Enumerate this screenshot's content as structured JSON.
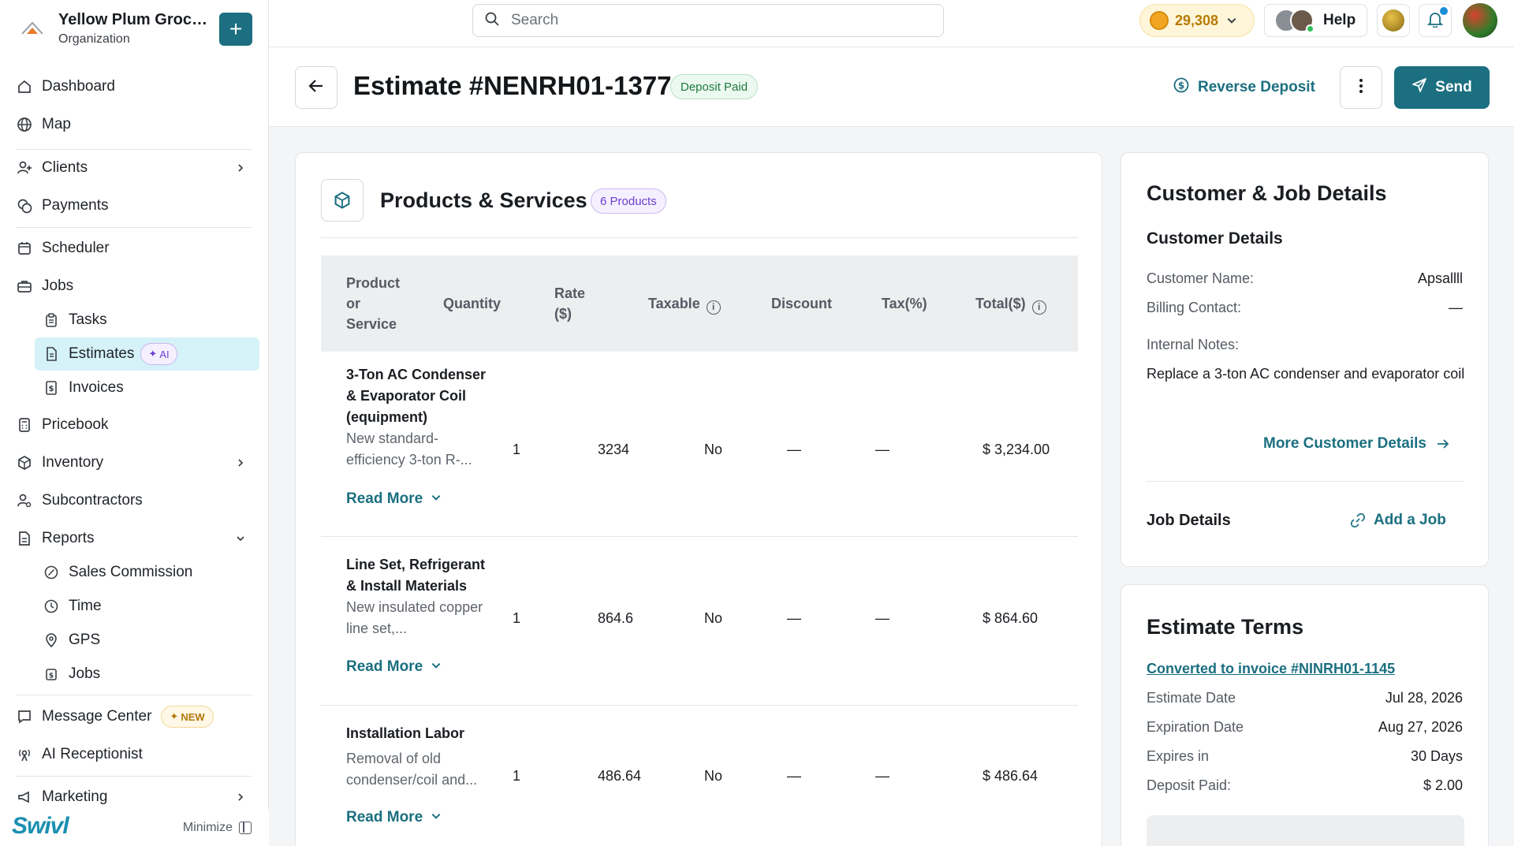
{
  "org": {
    "name": "Yellow Plum Grocers...",
    "type": "Organization"
  },
  "sidebar": {
    "items": [
      {
        "label": "Dashboard"
      },
      {
        "label": "Map"
      },
      {
        "label": "Clients"
      },
      {
        "label": "Payments"
      },
      {
        "label": "Scheduler"
      },
      {
        "label": "Jobs"
      },
      {
        "label": "Tasks"
      },
      {
        "label": "Estimates",
        "badge": "AI"
      },
      {
        "label": "Invoices"
      },
      {
        "label": "Pricebook"
      },
      {
        "label": "Inventory"
      },
      {
        "label": "Subcontractors"
      },
      {
        "label": "Reports"
      },
      {
        "label": "Sales Commission"
      },
      {
        "label": "Time"
      },
      {
        "label": "GPS"
      },
      {
        "label": "Jobs"
      },
      {
        "label": "Message Center",
        "badge": "NEW"
      },
      {
        "label": "AI Receptionist"
      },
      {
        "label": "Marketing"
      }
    ],
    "brand": "Swivl",
    "minimize_label": "Minimize"
  },
  "topbar": {
    "search_placeholder": "Search",
    "coins": "29,308",
    "help_label": "Help"
  },
  "header": {
    "title": "Estimate #NENRH01-1377",
    "status": "Deposit Paid",
    "reverse_label": "Reverse Deposit",
    "send_label": "Send"
  },
  "products": {
    "title": "Products & Services",
    "count_badge": "6 Products",
    "columns": {
      "product": "Product or Service",
      "quantity": "Quantity",
      "rate": "Rate ($)",
      "taxable": "Taxable",
      "discount": "Discount",
      "tax": "Tax(%)",
      "total": "Total($)"
    },
    "read_more": "Read More",
    "rows": [
      {
        "name": "3-Ton AC Condenser & Evaporator Coil (equipment)",
        "desc": "New standard-efficiency 3-ton R-...",
        "quantity": "1",
        "rate": "3234",
        "taxable": "No",
        "discount": "—",
        "tax": "—",
        "total": "$ 3,234.00"
      },
      {
        "name": "Line Set, Refrigerant & Install Materials",
        "desc": "New insulated copper line set,...",
        "quantity": "1",
        "rate": "864.6",
        "taxable": "No",
        "discount": "—",
        "tax": "—",
        "total": "$ 864.60"
      },
      {
        "name": "Installation Labor",
        "desc": "Removal of old condenser/coil and...",
        "quantity": "1",
        "rate": "486.64",
        "taxable": "No",
        "discount": "—",
        "tax": "—",
        "total": "$ 486.64"
      }
    ]
  },
  "customer": {
    "title": "Customer & Job Details",
    "section_title": "Customer Details",
    "name_label": "Customer Name:",
    "name_value": "Apsallll",
    "billing_label": "Billing Contact:",
    "billing_value": "—",
    "notes_label": "Internal Notes:",
    "notes_value": "Replace a 3-ton AC condenser and evaporator coil",
    "more_link": "More Customer Details",
    "job_title": "Job Details",
    "add_job": "Add a Job"
  },
  "terms": {
    "title": "Estimate Terms",
    "converted_link": "Converted to invoice #NINRH01-1145",
    "estimate_date_label": "Estimate Date",
    "estimate_date_value": "Jul 28, 2026",
    "expiration_label": "Expiration Date",
    "expiration_value": "Aug 27, 2026",
    "expires_in_label": "Expires in",
    "expires_in_value": "30 Days",
    "deposit_label": "Deposit Paid:",
    "deposit_value": "$ 2.00"
  }
}
